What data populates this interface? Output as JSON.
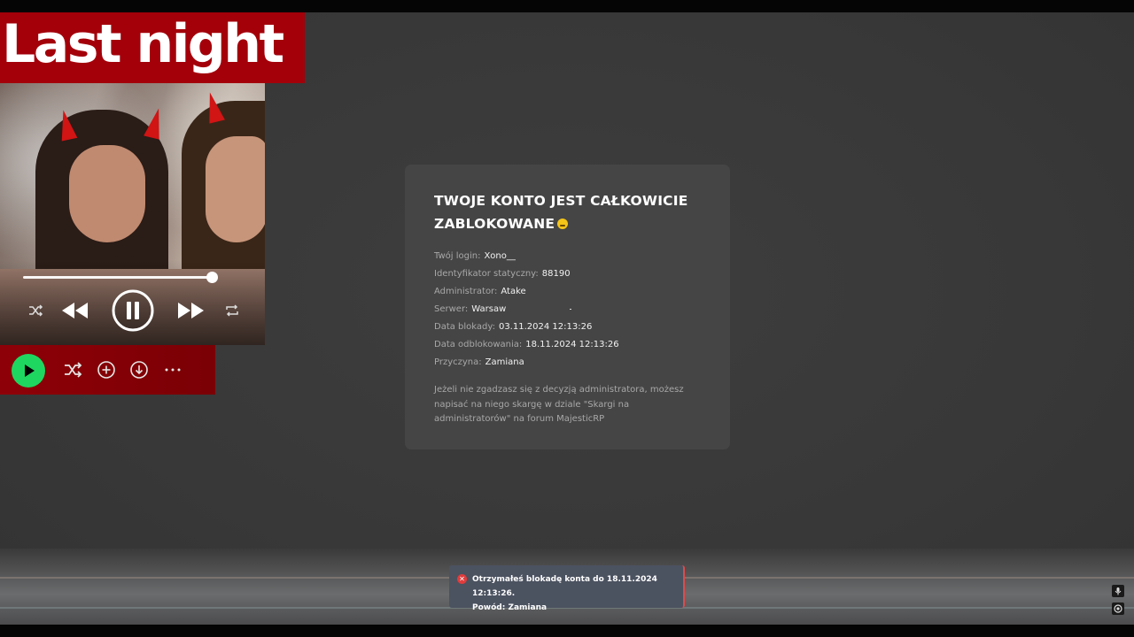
{
  "music_overlay": {
    "banner_title": "Last night"
  },
  "ban_panel": {
    "title": "TWOJE KONTO JEST CAŁKOWICIE ZABLOKOWANE",
    "rows": [
      {
        "label": "Twój login:",
        "value": "Xono__"
      },
      {
        "label": "Identyfikator statyczny:",
        "value": "88190"
      },
      {
        "label": "Administrator:",
        "value": "Atake"
      },
      {
        "label": "Serwer:",
        "value": "Warsaw"
      },
      {
        "label": "Data blokady:",
        "value": "03.11.2024 12:13:26"
      },
      {
        "label": "Data odblokowania:",
        "value": "18.11.2024 12:13:26"
      },
      {
        "label": "Przyczyna:",
        "value": "Zamiana"
      }
    ],
    "appeal_text": "Jeżeli nie zgadzasz się z decyzją administratora, możesz napisać na niego skargę w dziale \"Skargi na administratorów\" na forum MajesticRP"
  },
  "notification": {
    "line1": "Otrzymałeś blokadę konta do 18.11.2024 12:13:26.",
    "line2": "Powód: Zamiana",
    "accent_color": "#e04a4a"
  },
  "colors": {
    "banner_red": "#a3000a",
    "play_green": "#1ed760",
    "panel_bg": "#454545"
  }
}
